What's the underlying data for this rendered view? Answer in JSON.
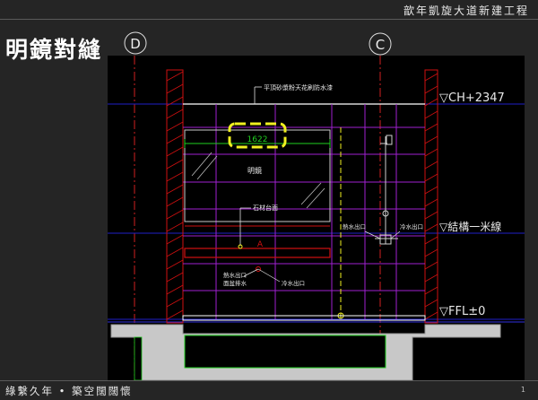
{
  "header": {
    "title": "歆年凱旋大道新建工程"
  },
  "page": {
    "title": "明鏡對縫"
  },
  "footer": {
    "text": "綠繫久年 • 築空闊闊懷",
    "slide_number": "1"
  },
  "grid": {
    "left_axis": "D",
    "right_axis": "C"
  },
  "levels": {
    "ceiling": "▽CH+2347",
    "datum": "▽結構一米線",
    "floor": "▽FFL±0"
  },
  "notes": {
    "ceiling_finish": "平頂砂漿粉天花刷防水漆",
    "mirror_width": "1622",
    "mirror": "明鏡",
    "stone_counter": "石材台面",
    "hot_water_outlet": "熱水出口",
    "cold_water_outlet": "冷水出口",
    "basin_hot_outlet": "熱水出口",
    "basin_drain": "面盆排水",
    "basin_cold_outlet": "冷水出口"
  },
  "marks": {
    "counter_tag": "A"
  },
  "colors": {
    "background": "#252525",
    "drawing_bg": "#000000",
    "wall_hatch": "#d01010",
    "tile_grid": "#a020d0",
    "level_line": "#2020c8",
    "green_line": "#20d020",
    "callout": "#f0f020",
    "slab": "#c8c8c8"
  }
}
